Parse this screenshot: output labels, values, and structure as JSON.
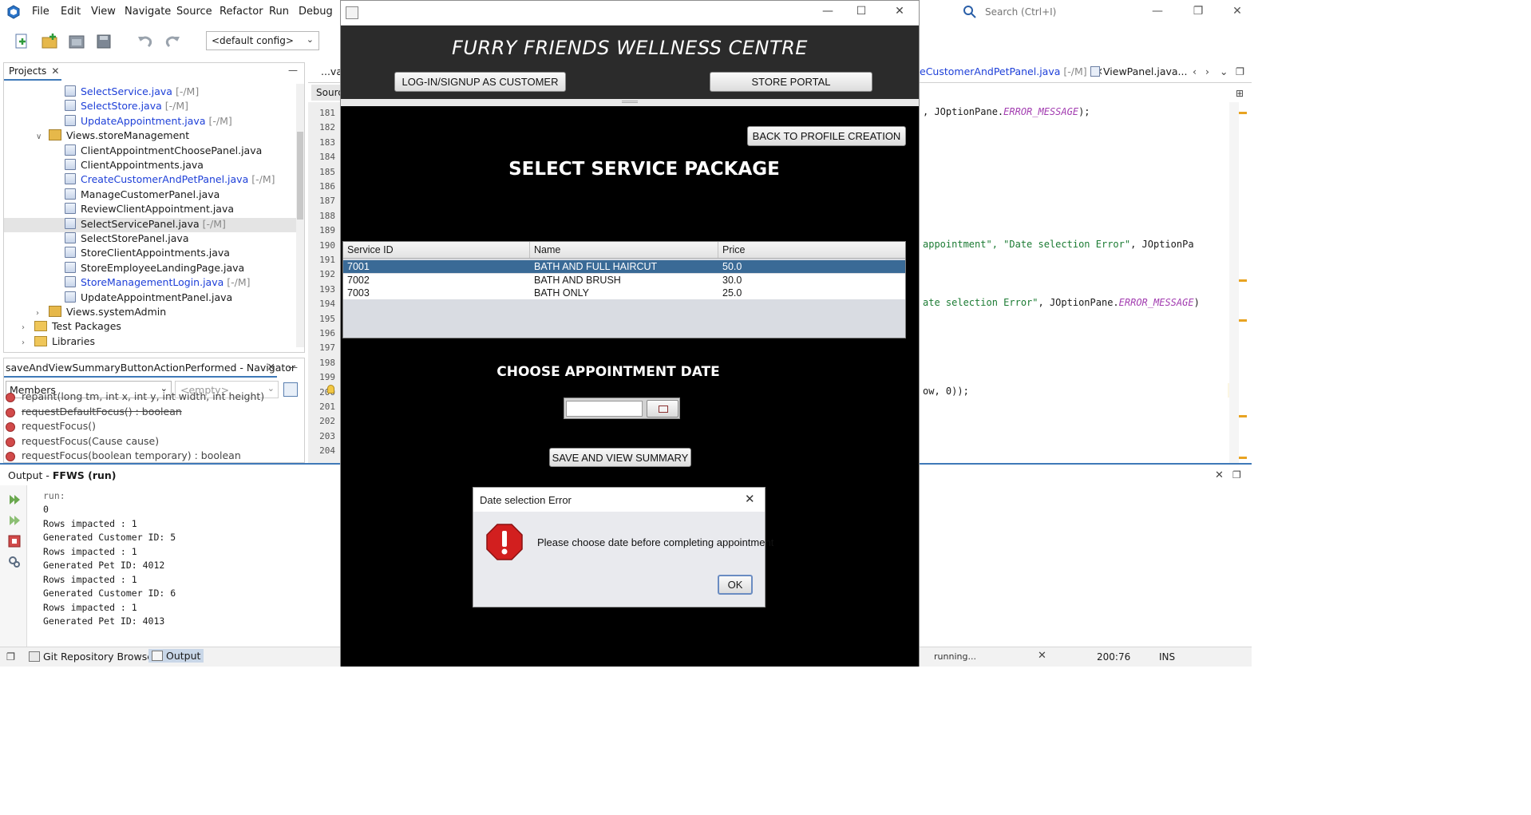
{
  "ide": {
    "menu": [
      "File",
      "Edit",
      "View",
      "Navigate",
      "Source",
      "Refactor",
      "Run",
      "Debug"
    ],
    "search_placeholder": "Search (Ctrl+I)",
    "toolbar": {
      "config": "<default config>"
    },
    "projects": {
      "tab_label": "Projects",
      "items": [
        {
          "label": "SelectService.java",
          "suffix": "[-/M]",
          "type": "file",
          "modified": true
        },
        {
          "label": "SelectStore.java",
          "suffix": "[-/M]",
          "type": "file",
          "modified": true
        },
        {
          "label": "UpdateAppointment.java",
          "suffix": "[-/M]",
          "type": "file",
          "modified": true
        },
        {
          "label": "Views.storeManagement",
          "suffix": "",
          "type": "package",
          "modified": false
        },
        {
          "label": "ClientAppointmentChoosePanel.java",
          "suffix": "",
          "type": "file",
          "modified": false
        },
        {
          "label": "ClientAppointments.java",
          "suffix": "",
          "type": "file",
          "modified": false
        },
        {
          "label": "CreateCustomerAndPetPanel.java",
          "suffix": "[-/M]",
          "type": "file",
          "modified": true
        },
        {
          "label": "ManageCustomerPanel.java",
          "suffix": "",
          "type": "file",
          "modified": false
        },
        {
          "label": "ReviewClientAppointment.java",
          "suffix": "",
          "type": "file",
          "modified": false
        },
        {
          "label": "SelectServicePanel.java",
          "suffix": "[-/M]",
          "type": "file",
          "modified": false,
          "selected": true
        },
        {
          "label": "SelectStorePanel.java",
          "suffix": "",
          "type": "file",
          "modified": false
        },
        {
          "label": "StoreClientAppointments.java",
          "suffix": "",
          "type": "file",
          "modified": false
        },
        {
          "label": "StoreEmployeeLandingPage.java",
          "suffix": "",
          "type": "file",
          "modified": false
        },
        {
          "label": "StoreManagementLogin.java",
          "suffix": "[-/M]",
          "type": "file",
          "modified": true
        },
        {
          "label": "UpdateAppointmentPanel.java",
          "suffix": "",
          "type": "file",
          "modified": false
        },
        {
          "label": "Views.systemAdmin",
          "suffix": "",
          "type": "package",
          "modified": false
        },
        {
          "label": "Test Packages",
          "suffix": "",
          "type": "folder",
          "modified": false
        },
        {
          "label": "Libraries",
          "suffix": "",
          "type": "folder",
          "modified": false
        }
      ]
    },
    "navigator": {
      "title": "saveAndViewSummaryButtonActionPerformed - Navigator",
      "filter": "Members",
      "empty": "<empty>",
      "items": [
        {
          "label": "repaint(long tm, int x, int y, int width, int height)",
          "deprecated": false
        },
        {
          "label": "requestDefaultFocus() : boolean",
          "deprecated": true
        },
        {
          "label": "requestFocus()",
          "deprecated": false
        },
        {
          "label": "requestFocus(Cause cause)",
          "deprecated": false
        },
        {
          "label": "requestFocus(boolean temporary) : boolean",
          "deprecated": false
        }
      ]
    },
    "editor": {
      "tabs": [
        {
          "label": "...va"
        },
        {
          "label": "eCustomerAndPetPanel.java",
          "suffix": "[-/M]"
        },
        {
          "label": "ViewPanel.java..."
        }
      ],
      "source_tab": "Source",
      "line_numbers": [
        "181",
        "182",
        "183",
        "184",
        "185",
        "186",
        "187",
        "188",
        "189",
        "190",
        "191",
        "192",
        "193",
        "194",
        "195",
        "196",
        "197",
        "198",
        "199",
        "200",
        "201",
        "202",
        "203",
        "204"
      ],
      "code_lines": [
        {
          "line": "181",
          "parts": [
            {
              "t": ", JOptionPane.",
              "c": ""
            },
            {
              "t": "ERROR_MESSAGE",
              "c": "const"
            },
            {
              "t": ");",
              "c": ""
            }
          ]
        },
        {
          "line": "190",
          "parts": [
            {
              "t": "appointment\", ",
              "c": "str"
            },
            {
              "t": "\"Date selection Error\"",
              "c": "str"
            },
            {
              "t": ", JOptionPa",
              "c": ""
            }
          ]
        },
        {
          "line": "194",
          "parts": [
            {
              "t": "ate selection Error\"",
              "c": "str"
            },
            {
              "t": ", JOptionPane.",
              "c": ""
            },
            {
              "t": "ERROR_MESSAGE",
              "c": "const"
            },
            {
              "t": ")",
              "c": ""
            }
          ]
        },
        {
          "line": "200",
          "parts": [
            {
              "t": "ow, 0));",
              "c": ""
            }
          ]
        }
      ]
    },
    "output": {
      "label": "Output - ",
      "project": "FFWS (run)",
      "lines": [
        "run:",
        "0",
        "Rows impacted : 1",
        "Generated Customer ID: 5",
        "Rows impacted : 1",
        "Generated Pet ID: 4012",
        "Rows impacted : 1",
        "Generated Customer ID: 6",
        "Rows impacted : 1",
        "Generated Pet ID: 4013"
      ]
    },
    "status": {
      "git_tab": "Git Repository Browser",
      "output_tab": "Output",
      "running": "running...",
      "position": "200:76",
      "mode": "INS"
    }
  },
  "app": {
    "title": "FURRY FRIENDS WELLNESS CENTRE",
    "login_button": "LOG-IN/SIGNUP AS CUSTOMER",
    "store_button": "STORE PORTAL",
    "back_button": "BACK TO PROFILE CREATION",
    "service_heading": "SELECT SERVICE PACKAGE",
    "table": {
      "columns": [
        "Service ID",
        "Name",
        "Price"
      ],
      "rows": [
        {
          "id": "7001",
          "name": "BATH AND FULL HAIRCUT",
          "price": "50.0",
          "selected": true
        },
        {
          "id": "7002",
          "name": "BATH AND BRUSH",
          "price": "30.0",
          "selected": false
        },
        {
          "id": "7003",
          "name": "BATH ONLY",
          "price": "25.0",
          "selected": false
        }
      ]
    },
    "date_heading": "CHOOSE APPOINTMENT DATE",
    "date_value": "",
    "save_button": "SAVE AND VIEW SUMMARY"
  },
  "dialog": {
    "title": "Date selection Error",
    "message": "Please choose date before completing appointment",
    "ok": "OK"
  },
  "colors": {
    "selection": "#3a6a96",
    "header_bg": "#2b2b2b",
    "modified_file": "#1d3fd8",
    "error_icon": "#d21f1f",
    "accent": "#3f79b8"
  }
}
